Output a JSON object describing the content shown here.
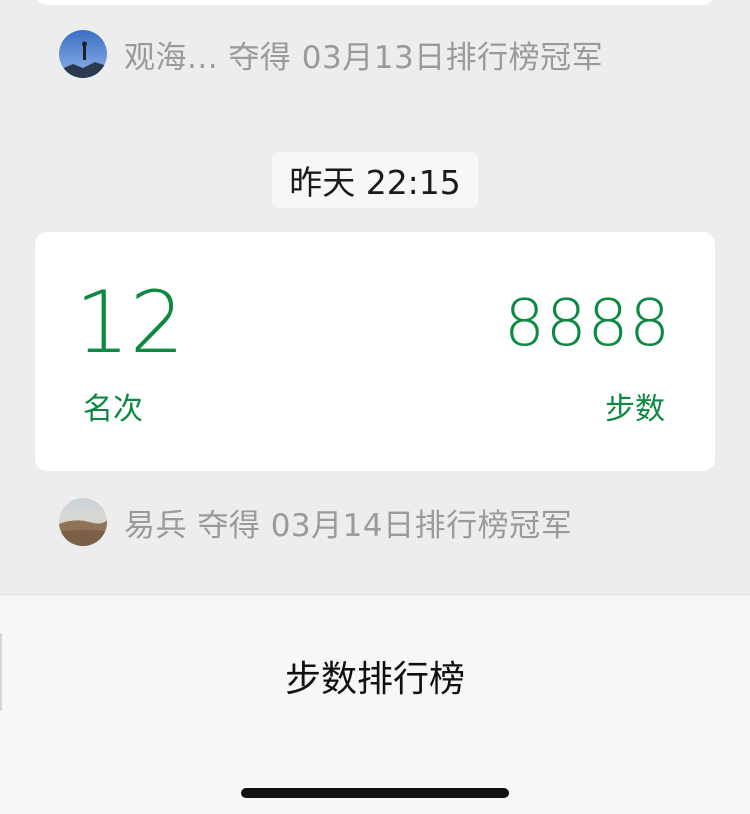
{
  "messages": [
    {
      "champion_text": "观海... 夺得 03月13日排行榜冠军"
    }
  ],
  "timestamp": "昨天 22:15",
  "rank_card": {
    "rank_value": "12",
    "rank_label": "名次",
    "steps_value": "8888",
    "steps_label": "步数"
  },
  "second_champion": {
    "champion_text": "易兵 夺得 03月14日排行榜冠军"
  },
  "bottom_bar": {
    "title": "步数排行榜"
  },
  "colors": {
    "accent_green": "#0d8a42",
    "background": "#ededed",
    "muted_text": "#9a9a9a"
  }
}
